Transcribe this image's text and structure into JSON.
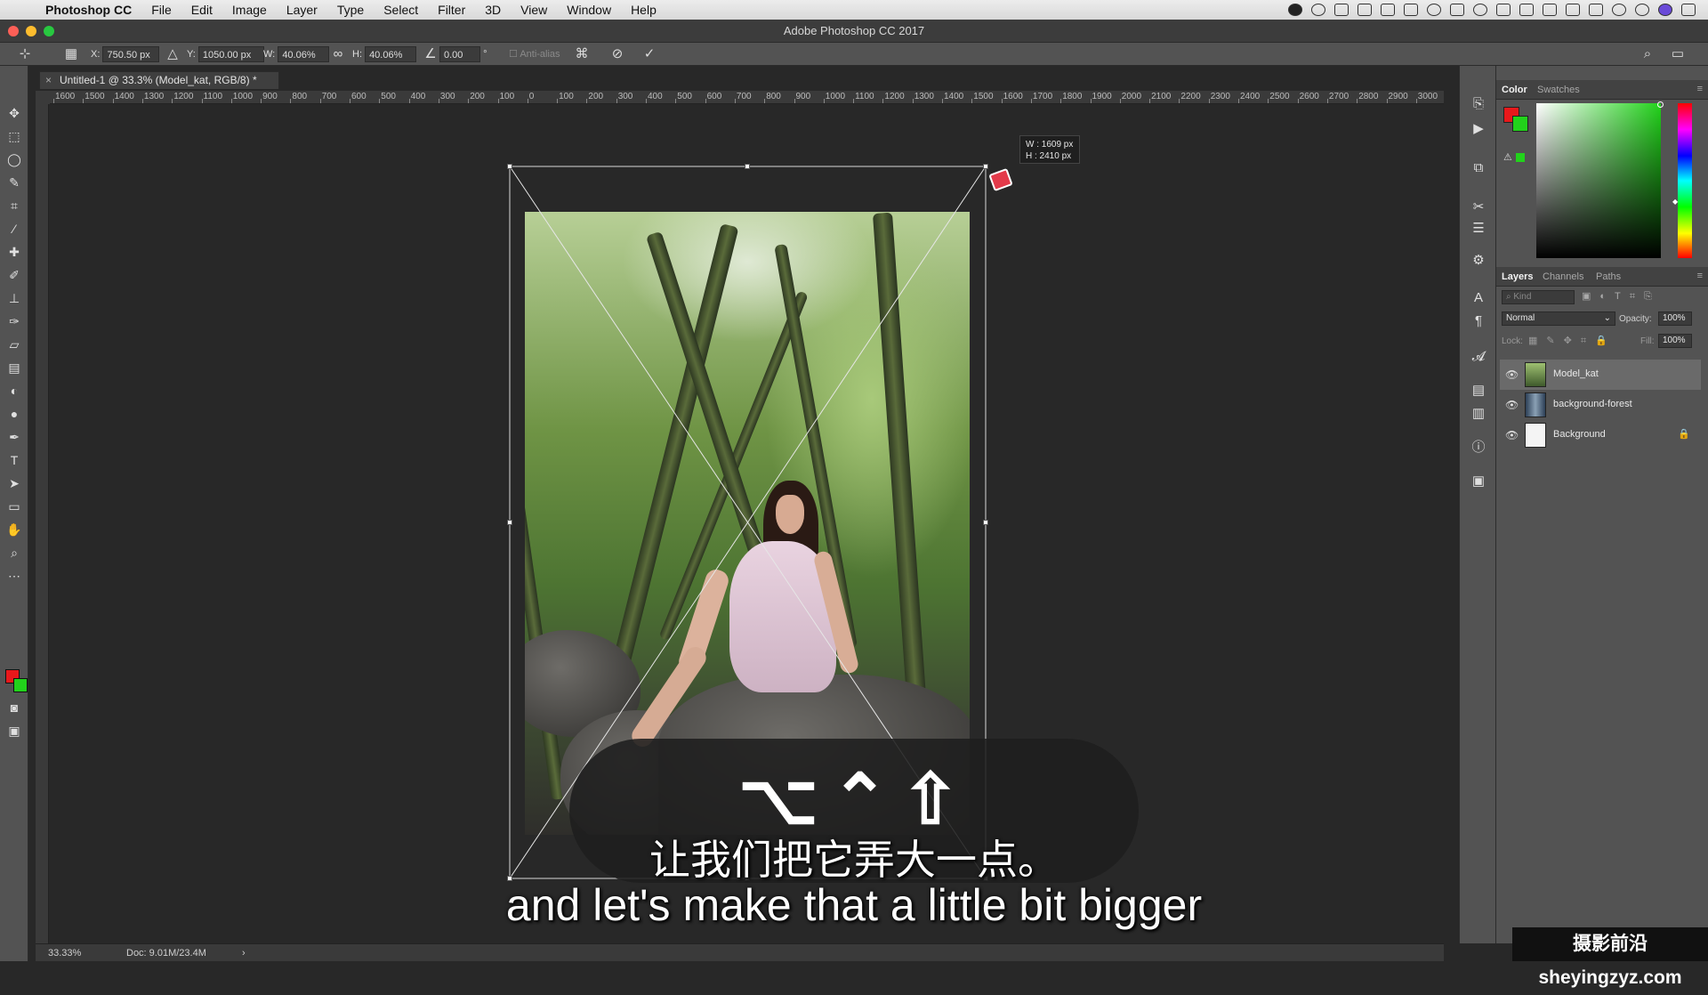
{
  "menubar": {
    "app": "Photoshop CC",
    "items": [
      "File",
      "Edit",
      "Image",
      "Layer",
      "Type",
      "Select",
      "Filter",
      "3D",
      "View",
      "Window",
      "Help"
    ]
  },
  "window": {
    "title": "Adobe Photoshop CC 2017"
  },
  "options": {
    "x_label": "X:",
    "x_value": "750.50 px",
    "y_label": "Y:",
    "y_value": "1050.00 px",
    "w_label": "W:",
    "w_value": "40.06%",
    "h_label": "H:",
    "h_value": "40.06%",
    "angle_value": "0.00",
    "angle_unit": "°",
    "antialias_label": "Anti-alias"
  },
  "document": {
    "tab_title": "Untitled-1 @ 33.3% (Model_kat, RGB/8) *",
    "close": "×"
  },
  "ruler": {
    "h_labels": [
      "1600",
      "1500",
      "1400",
      "1300",
      "1200",
      "1100",
      "1000",
      "900",
      "800",
      "700",
      "600",
      "500",
      "400",
      "300",
      "200",
      "100",
      "0",
      "100",
      "200",
      "300",
      "400",
      "500",
      "600",
      "700",
      "800",
      "900",
      "1000",
      "1100",
      "1200",
      "1300",
      "1400",
      "1500",
      "1600",
      "1700",
      "1800",
      "1900",
      "2000",
      "2100",
      "2200",
      "2300",
      "2400",
      "2500",
      "2600",
      "2700",
      "2800",
      "2900",
      "3000"
    ]
  },
  "transform": {
    "size_w": "W : 1609 px",
    "size_h": "H : 2410 px"
  },
  "panels": {
    "color_tabs": [
      "Color",
      "Swatches"
    ],
    "foreground": "#e8181b",
    "background": "#22d21b",
    "layers_tabs": [
      "Layers",
      "Channels",
      "Paths"
    ],
    "kind_placeholder": "Kind",
    "blend_mode": "Normal",
    "opacity_label": "Opacity:",
    "opacity_value": "100%",
    "lock_label": "Lock:",
    "fill_label": "Fill:",
    "fill_value": "100%",
    "layers": [
      {
        "name": "Model_kat",
        "selected": true
      },
      {
        "name": "background-forest",
        "selected": false
      },
      {
        "name": "Background",
        "selected": false,
        "locked": true
      }
    ]
  },
  "status": {
    "zoom": "33.33%",
    "doc": "Doc: 9.01M/23.4M",
    "arrow": "›"
  },
  "subtitle": {
    "keys": "⌥⌃⇧",
    "cn": "让我们把它弄大一点。",
    "en": "and let's make that a little bit bigger"
  },
  "watermark": "摄影前沿 sheyingzyz.com"
}
